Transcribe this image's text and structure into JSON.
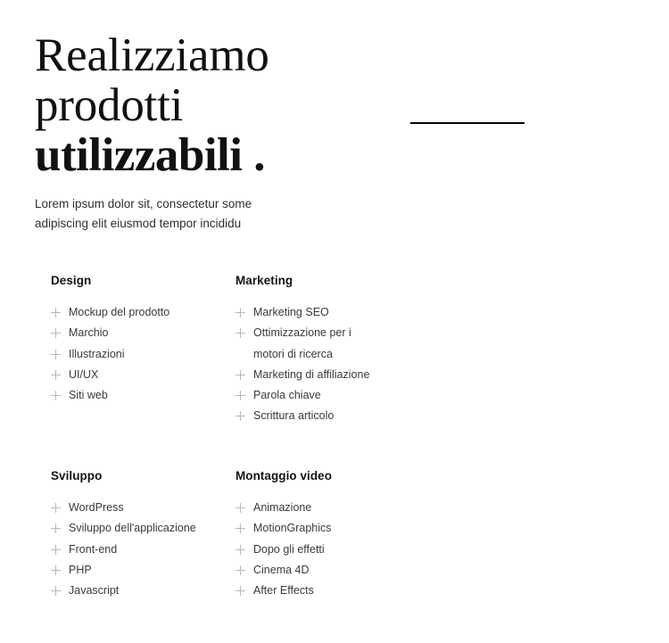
{
  "hero": {
    "title_line1": "Realizziamo",
    "title_line2": "prodotti",
    "title_line3": "utilizzabili .",
    "subtitle_line1": "Lorem ipsum dolor sit, consectetur some",
    "subtitle_line2": "adipiscing elit eiusmod tempor incididu"
  },
  "divider": {
    "color": "#050505"
  },
  "colors": {
    "background": "#ffffff",
    "title": "#111111",
    "body_text": "#3a3a3a",
    "heading_text": "#141414",
    "plus_icon": "#b8b8b8"
  },
  "columns": [
    {
      "title": "Design",
      "items": [
        {
          "label": "Mockup del prodotto",
          "icon": "plus-icon"
        },
        {
          "label": "Marchio",
          "icon": "plus-icon"
        },
        {
          "label": "Illustrazioni",
          "icon": "plus-icon"
        },
        {
          "label": "UI/UX",
          "icon": "plus-icon"
        },
        {
          "label": "Siti web",
          "icon": "plus-icon"
        }
      ]
    },
    {
      "title": "Marketing",
      "items": [
        {
          "label": "Marketing SEO",
          "icon": "plus-icon"
        },
        {
          "label": "Ottimizzazione per i",
          "label2": "motori di ricerca",
          "icon": "plus-icon"
        },
        {
          "label": "Marketing di affiliazione",
          "icon": "plus-icon"
        },
        {
          "label": "Parola chiave",
          "icon": "plus-icon"
        },
        {
          "label": "Scrittura articolo",
          "icon": "plus-icon"
        }
      ]
    },
    {
      "title": "Sviluppo",
      "items": [
        {
          "label": "WordPress",
          "icon": "plus-icon"
        },
        {
          "label": "Sviluppo dell'applicazione",
          "icon": "plus-icon"
        },
        {
          "label": "Front-end",
          "icon": "plus-icon"
        },
        {
          "label": "PHP",
          "icon": "plus-icon"
        },
        {
          "label": "Javascript",
          "icon": "plus-icon"
        }
      ]
    },
    {
      "title": "Montaggio video",
      "items": [
        {
          "label": "Animazione",
          "icon": "plus-icon"
        },
        {
          "label": "MotionGraphics",
          "icon": "plus-icon"
        },
        {
          "label": "Dopo gli effetti",
          "icon": "plus-icon"
        },
        {
          "label": "Cinema 4D",
          "icon": "plus-icon"
        },
        {
          "label": "After Effects",
          "icon": "plus-icon"
        }
      ]
    }
  ]
}
